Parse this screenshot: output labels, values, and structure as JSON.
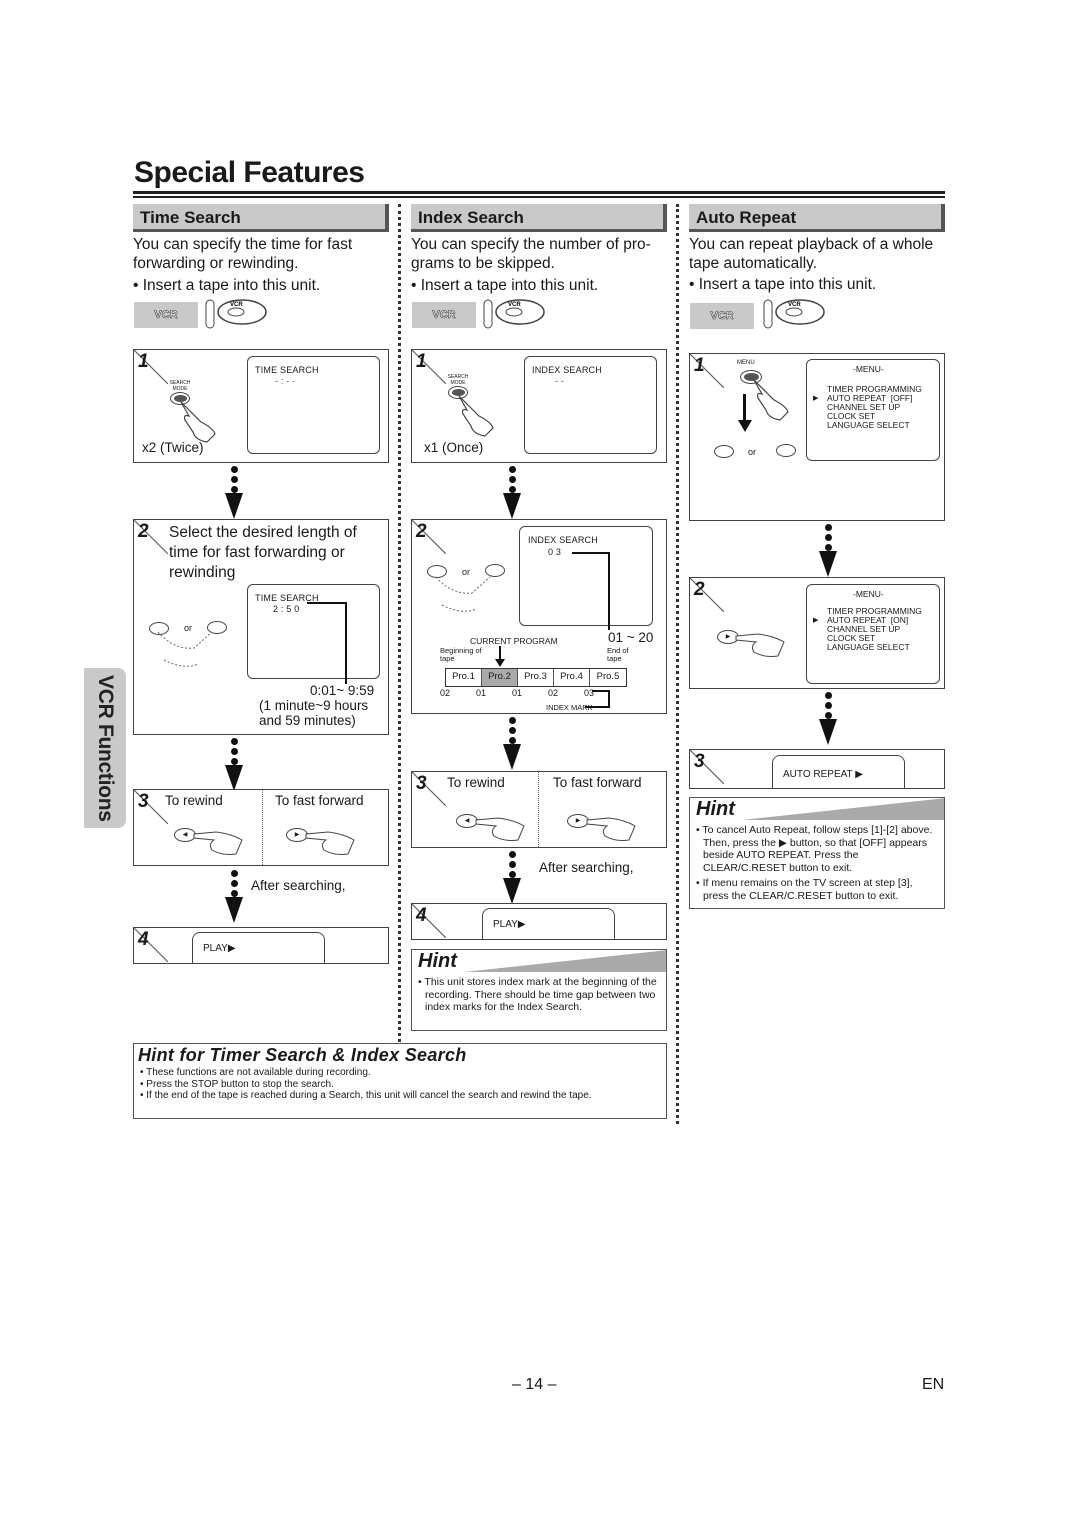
{
  "page": {
    "title": "Special Features",
    "side_tab": "VCR Functions",
    "page_number": "– 14 –",
    "language": "EN"
  },
  "sections": {
    "time_search": {
      "header": "Time Search",
      "intro": "You can specify the time for fast forwarding or rewinding.",
      "bullet": "• Insert a tape into this unit.",
      "vcr_badge": "VCR",
      "remote_label": "VCR",
      "step1": {
        "num": "1",
        "button_label": "SEARCH MODE",
        "screen_title": "TIME SEARCH",
        "screen_value": "- : - -",
        "press_count": "x2 (Twice)"
      },
      "step2": {
        "num": "2",
        "instruction": "Select the desired length of time for fast forwarding or rewinding",
        "or": "or",
        "screen_title": "TIME SEARCH",
        "screen_value": "2 : 5 0",
        "range": "0:01~ 9:59",
        "range_desc1": "(1 minute~9 hours",
        "range_desc2": "and 59 minutes)"
      },
      "step3": {
        "num": "3",
        "rewind": "To rewind",
        "ffwd": "To fast forward"
      },
      "after": "After searching,",
      "step4": {
        "num": "4",
        "screen_text": "PLAY▶"
      }
    },
    "index_search": {
      "header": "Index Search",
      "intro": "You can specify the number of pro- grams to be skipped.",
      "bullet": "• Insert a tape into this unit.",
      "vcr_badge": "VCR",
      "remote_label": "VCR",
      "step1": {
        "num": "1",
        "button_label": "SEARCH MODE",
        "screen_title": "INDEX SEARCH",
        "screen_value": "- -",
        "press_count": "x1 (Once)"
      },
      "step2": {
        "num": "2",
        "or": "or",
        "screen_title": "INDEX SEARCH",
        "screen_value": "0 3",
        "range": "01 ~ 20",
        "current_program": "CURRENT PROGRAM",
        "beginning": "Beginning of tape",
        "end": "End of tape",
        "programs": [
          "Pro.1",
          "Pro.2",
          "Pro.3",
          "Pro.4",
          "Pro.5"
        ],
        "current_index": 1,
        "marks": [
          "02",
          "01",
          "01",
          "02",
          "03"
        ],
        "index_mark": "INDEX MARK"
      },
      "step3": {
        "num": "3",
        "rewind": "To rewind",
        "ffwd": "To fast forward"
      },
      "after": "After searching,",
      "step4": {
        "num": "4",
        "screen_text": "PLAY▶"
      },
      "hint": {
        "title": "Hint",
        "items": [
          "• This unit stores index mark at the beginning of the recording. There should be time gap between two index marks for the Index Search."
        ]
      }
    },
    "auto_repeat": {
      "header": "Auto Repeat",
      "intro": "You can repeat playback of a whole tape automatically.",
      "bullet": "• Insert a tape into this unit.",
      "vcr_badge": "VCR",
      "remote_label": "VCR",
      "step1": {
        "num": "1",
        "button_label": "MENU",
        "or": "or",
        "menu_title": "-MENU-",
        "menu_items": [
          "TIMER PROGRAMMING",
          "AUTO REPEAT  [OFF]",
          "CHANNEL SET UP",
          "CLOCK SET",
          "LANGUAGE SELECT"
        ],
        "selected": 1
      },
      "step2": {
        "num": "2",
        "menu_title": "-MENU-",
        "menu_items": [
          "TIMER PROGRAMMING",
          "AUTO REPEAT  [ON]",
          "CHANNEL SET UP",
          "CLOCK SET",
          "LANGUAGE SELECT"
        ],
        "selected": 1
      },
      "step3": {
        "num": "3",
        "screen_text": "AUTO REPEAT ▶"
      },
      "hint": {
        "title": "Hint",
        "items": [
          "• To cancel Auto Repeat, follow steps [1]-[2] above. Then, press the ▶ button, so that [OFF] appears beside AUTO REPEAT.  Press the CLEAR/C.RESET button to exit.",
          "• If menu remains on the TV screen at step [3], press the CLEAR/C.RESET button to exit."
        ]
      }
    }
  },
  "bottom_hint": {
    "title": "Hint for Timer Search & Index Search",
    "items": [
      "• These functions are not available during recording.",
      "• Press the STOP button to stop the search.",
      "• If the end of the tape is reached during a Search, this unit will cancel the search and rewind the tape."
    ]
  }
}
